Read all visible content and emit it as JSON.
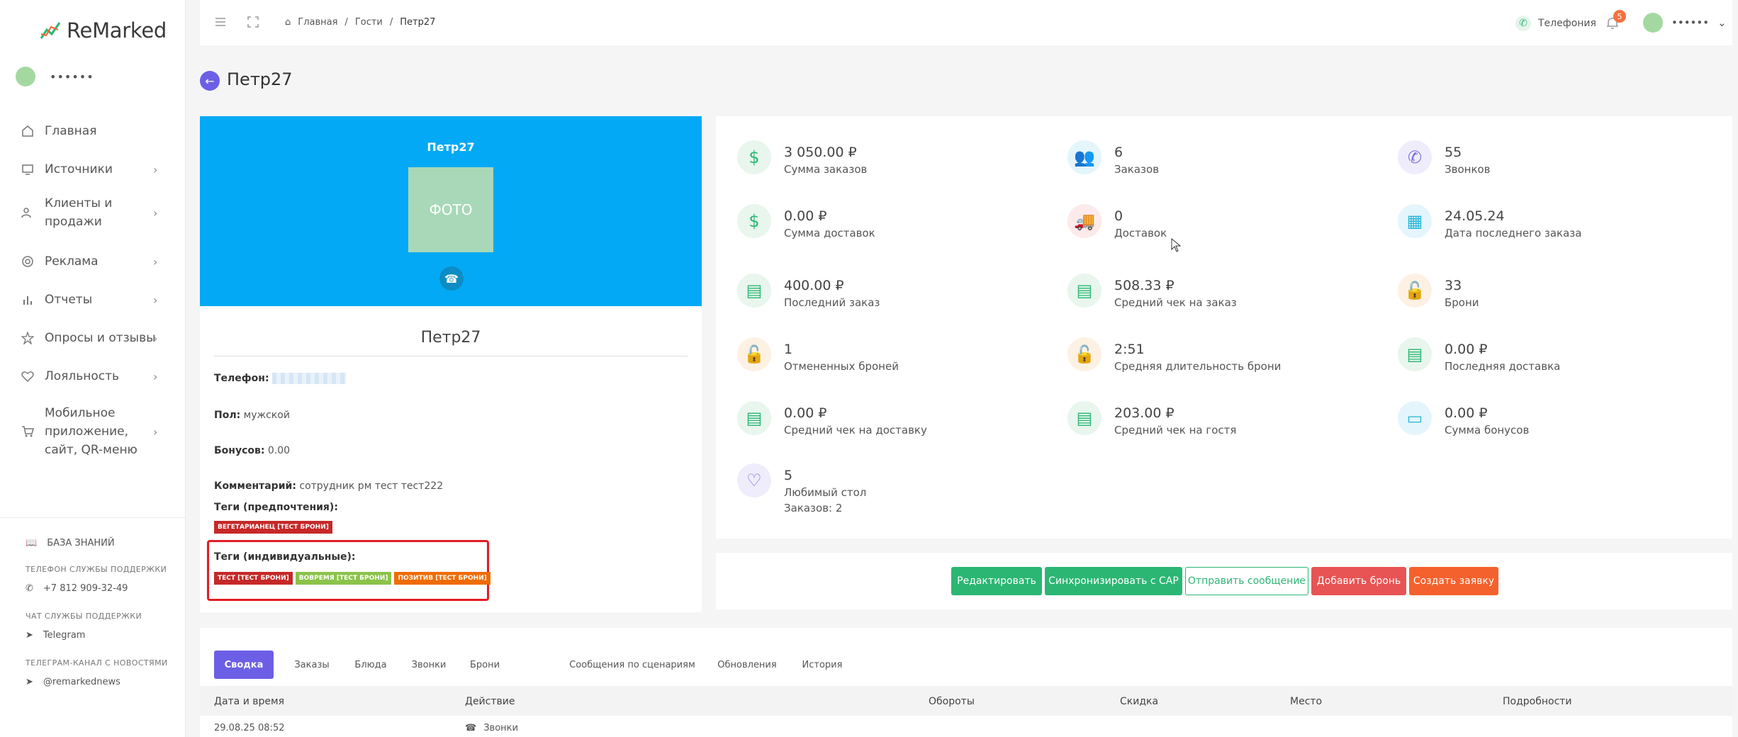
{
  "app": {
    "logo_text": "ReMarked",
    "user_name": "••••••"
  },
  "sidebar": {
    "items": [
      {
        "label": "Главная",
        "icon": "home-icon"
      },
      {
        "label": "Источники",
        "icon": "monitor-icon"
      },
      {
        "label": "Клиенты и продажи",
        "icon": "users-icon"
      },
      {
        "label": "Реклама",
        "icon": "target-icon"
      },
      {
        "label": "Отчеты",
        "icon": "bar-chart-icon"
      },
      {
        "label": "Опросы и отзывы",
        "icon": "star-icon"
      },
      {
        "label": "Лояльность",
        "icon": "heart-icon"
      },
      {
        "label": "Мобильное приложение, сайт, QR-меню",
        "icon": "cart-icon"
      }
    ],
    "knowledge_base": "БАЗА ЗНАНИЙ",
    "support_phone_caption": "ТЕЛЕФОН СЛУЖБЫ ПОДДЕРЖКИ",
    "support_phone": "+7 812 909-32-49",
    "support_chat_caption": "ЧАТ СЛУЖБЫ ПОДДЕРЖКИ",
    "support_chat": "Telegram",
    "news_caption": "ТЕЛЕГРАМ-КАНАЛ С НОВОСТЯМИ",
    "news_channel": "@remarkednews"
  },
  "topbar": {
    "breadcrumbs": [
      "Главная",
      "Гости",
      "Петр27"
    ],
    "telephony": "Телефония",
    "notifications_count": "5",
    "user_name": "••••••"
  },
  "page": {
    "title": "Петр27"
  },
  "profile": {
    "hero_name": "Петр27",
    "photo_label": "ФОТО",
    "name": "Петр27",
    "phone_label": "Телефон:",
    "gender_label": "Пол:",
    "gender": "мужской",
    "bonus_label": "Бонусов:",
    "bonus": "0.00",
    "comment_label": "Комментарий:",
    "comment": "сотрудник рм тест тест222",
    "pref_tags_label": "Теги (предпочтения):",
    "pref_tags": [
      {
        "label": "ВЕГЕТАРИАНЕЦ [ТЕСТ БРОНИ]",
        "color": "#c62828"
      }
    ],
    "ind_tags_label": "Теги (индивидуальные):",
    "ind_tags": [
      {
        "label": "ТЕСТ [ТЕСТ БРОНИ]",
        "color": "#c62828"
      },
      {
        "label": "ВОВРЕМЯ [ТЕСТ БРОНИ]",
        "color": "#8bc34a"
      },
      {
        "label": "ПОЗИТИВ [ТЕСТ БРОНИ]",
        "color": "#ef6c00"
      }
    ]
  },
  "stats": [
    {
      "value": "3 050.00 ₽",
      "caption": "Сумма заказов",
      "icon": "dollar-icon",
      "color": "#2bb673",
      "bg": "#e8f6ee"
    },
    {
      "value": "6",
      "caption": "Заказов",
      "icon": "users-icon",
      "color": "#26b5d9",
      "bg": "#e4f6fb"
    },
    {
      "value": "55",
      "caption": "Звонков",
      "icon": "phone-icon",
      "color": "#7a6fe0",
      "bg": "#efedfb"
    },
    {
      "value": "0.00 ₽",
      "caption": "Сумма доставок",
      "icon": "dollar-icon",
      "color": "#2bb673",
      "bg": "#e8f6ee"
    },
    {
      "value": "0",
      "caption": "Доставок",
      "icon": "truck-icon",
      "color": "#e85454",
      "bg": "#fdeaea"
    },
    {
      "value": "24.05.24",
      "caption": "Дата последнего заказа",
      "icon": "calendar-icon",
      "color": "#26b5d9",
      "bg": "#e4f6fb"
    },
    {
      "value": "400.00 ₽",
      "caption": "Последний заказ",
      "icon": "document-icon",
      "color": "#2bb673",
      "bg": "#e8f6ee"
    },
    {
      "value": "508.33 ₽",
      "caption": "Средний чек на заказ",
      "icon": "document-icon",
      "color": "#2bb673",
      "bg": "#e8f6ee"
    },
    {
      "value": "33",
      "caption": "Брони",
      "icon": "lock-icon",
      "color": "#f5a34b",
      "bg": "#fdf1e4"
    },
    {
      "value": "1",
      "caption": "Отмененных броней",
      "icon": "lock-icon",
      "color": "#f5a34b",
      "bg": "#fdf1e4"
    },
    {
      "value": "2:51",
      "caption": "Средняя длительность брони",
      "icon": "lock-icon",
      "color": "#f5a34b",
      "bg": "#fdf1e4"
    },
    {
      "value": "0.00 ₽",
      "caption": "Последняя доставка",
      "icon": "document-icon",
      "color": "#2bb673",
      "bg": "#e8f6ee"
    },
    {
      "value": "0.00 ₽",
      "caption": "Средний чек на доставку",
      "icon": "document-icon",
      "color": "#2bb673",
      "bg": "#e8f6ee"
    },
    {
      "value": "203.00 ₽",
      "caption": "Средний чек на гостя",
      "icon": "document-icon",
      "color": "#2bb673",
      "bg": "#e8f6ee"
    },
    {
      "value": "0.00 ₽",
      "caption": "Сумма бонусов",
      "icon": "card-icon",
      "color": "#26b5d9",
      "bg": "#e4f6fb"
    },
    {
      "value": "5",
      "caption": "Любимый стол",
      "caption2": "Заказов: 2",
      "icon": "heart-icon",
      "color": "#7a6fe0",
      "bg": "#efedfb"
    }
  ],
  "actions": [
    {
      "label": "Редактировать",
      "bg": "#2bb673",
      "fg": "#ffffff"
    },
    {
      "label": "Синхронизировать с CAP",
      "bg": "#2bb673",
      "fg": "#ffffff"
    },
    {
      "label": "Отправить сообщение",
      "bg": "#ffffff",
      "fg": "#2bb673"
    },
    {
      "label": "Добавить бронь",
      "bg": "#e85454",
      "fg": "#ffffff"
    },
    {
      "label": "Создать заявку",
      "bg": "#f5612c",
      "fg": "#ffffff"
    }
  ],
  "tabs": [
    "Сводка",
    "Заказы",
    "Блюда",
    "Звонки",
    "Брони",
    "Сообщения по сценариям",
    "Обновления",
    "История"
  ],
  "table": {
    "headers": [
      "Дата и время",
      "Действие",
      "Обороты",
      "Скидка",
      "Место",
      "Подробности"
    ],
    "rows": [
      {
        "datetime": "29.08.25 08:52",
        "action": "Звонки"
      }
    ]
  }
}
